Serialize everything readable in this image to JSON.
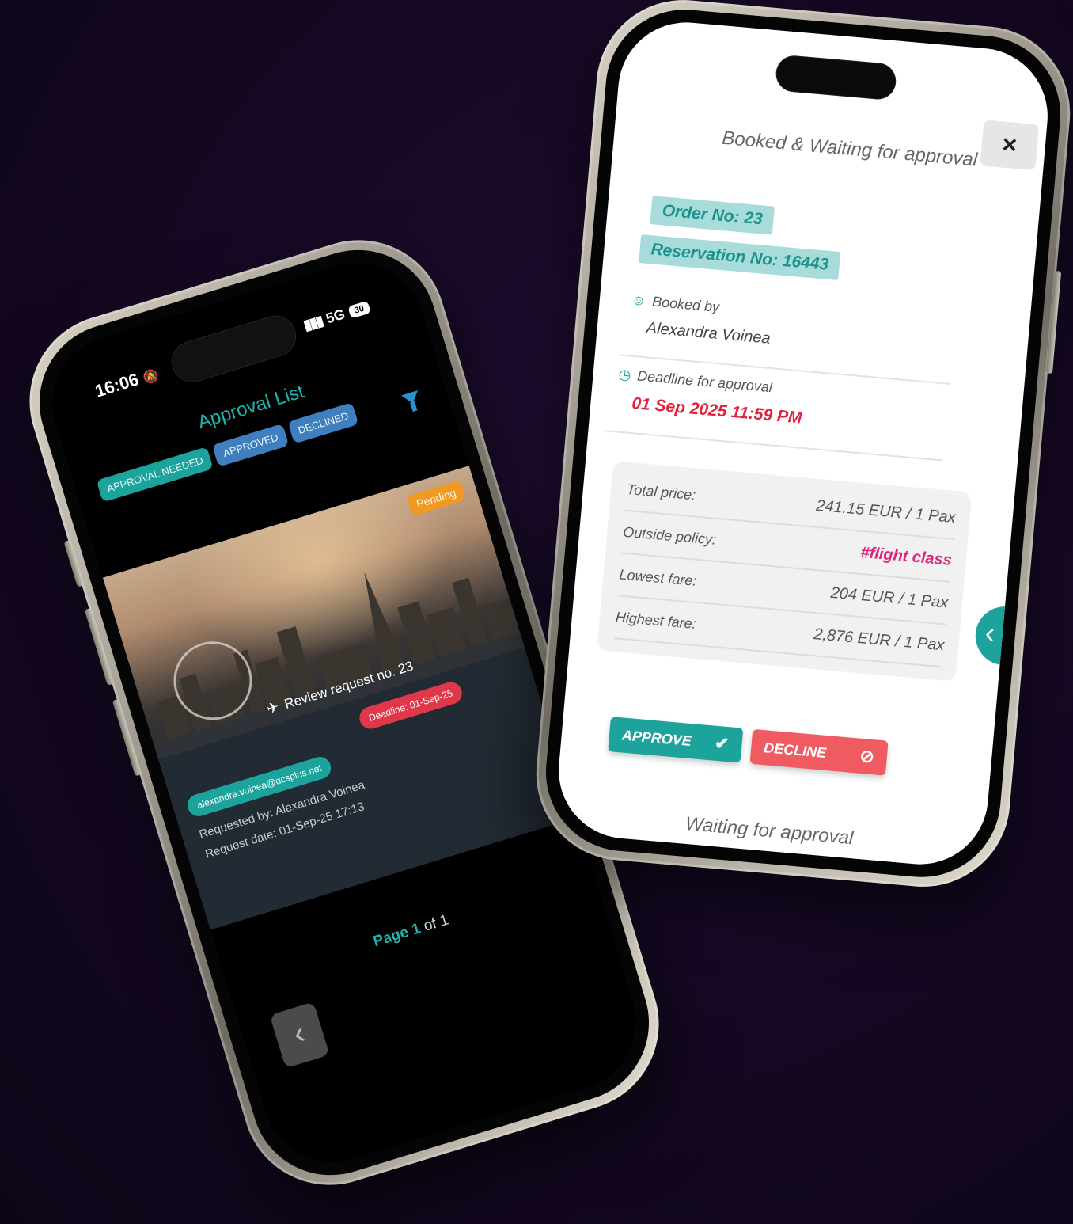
{
  "left_phone": {
    "status": {
      "time": "16:06",
      "signal": "5G",
      "battery": "30"
    },
    "title": "Approval List",
    "tabs": [
      {
        "label": "APPROVAL NEEDED"
      },
      {
        "label": "APPROVED"
      },
      {
        "label": "DECLINED"
      }
    ],
    "card": {
      "status_badge": "Pending",
      "review_text": "Review request no. 23",
      "deadline": "Deadline: 01-Sep-25",
      "email": "alexandra.voinea@dcsplus.net",
      "requested_by": "Requested by: Alexandra Voinea",
      "request_date": "Request date: 01-Sep-25 17:13"
    },
    "pagination": {
      "page_word": "Page",
      "current": "1",
      "of_text": "of 1"
    },
    "icons": {
      "filter": "filter-icon",
      "back": "chevron-left-icon",
      "plane": "plane-icon"
    }
  },
  "right_phone": {
    "title": "Booked & Waiting for approval",
    "close_label": "×",
    "order_no": "Order No: 23",
    "reservation_no": "Reservation No: 16443",
    "booked_by_label": "Booked by",
    "booked_by_name": "Alexandra Voinea",
    "deadline_label": "Deadline for approval",
    "deadline_value": "01 Sep 2025 11:59 PM",
    "prices": [
      {
        "label": "Total price:",
        "value": "241.15 EUR / 1 Pax"
      },
      {
        "label": "Outside policy:",
        "value": "#flight class"
      },
      {
        "label": "Lowest fare:",
        "value": "204 EUR / 1 Pax"
      },
      {
        "label": "Highest fare:",
        "value": "2,876 EUR / 1 Pax"
      }
    ],
    "approve_label": "APPROVE",
    "decline_label": "DECLINE",
    "waiting_text": "Waiting for approval"
  },
  "colors": {
    "accent": "#1ba39c",
    "danger": "#e0384a",
    "pending": "#f19a22",
    "tab_blue": "#3f7fbf",
    "background": "#150822"
  }
}
